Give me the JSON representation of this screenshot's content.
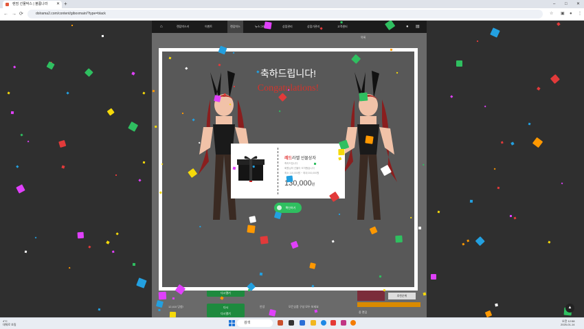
{
  "browser": {
    "tab_title": "랜덤 선물박스 | 볼룸나라",
    "new_tab": "+",
    "minimize": "–",
    "maximize": "□",
    "close": "✕",
    "back": "←",
    "forward": "→",
    "reload": "⟳",
    "url": "dolrama2.com/content/giboxmain/?type=black"
  },
  "site_nav": {
    "home": "⌂",
    "items": [
      "랜덤박스키",
      "이벤트",
      "랜덤박스",
      "뉴스그래픽",
      "상점관리",
      "상점가관리",
      "고객센터"
    ],
    "active_index": 2
  },
  "modal": {
    "title_ko": "축하드립니다!",
    "title_en": "Congatulations!",
    "product": {
      "name_prefix": "레드",
      "name_rest": "라벨 선물상자",
      "line1": "축하드립니다",
      "line2": "회원님의 선물이 도착했습니다",
      "line3": "최소 110,000원 ~ 최대 200,000원",
      "price": "130,000",
      "price_unit": "원"
    },
    "confirm_label": "확인하기"
  },
  "page_below": {
    "btn1": "다시열기",
    "btn2_line1": "다시",
    "btn2_line2": "다시열기",
    "text1": "12,410 당첨!",
    "text2": "안녕",
    "text3": "모든상품 구성 모두 보세요",
    "right_badge": "추천순위",
    "right_label": "중 랜덤",
    "right_top": "목록"
  },
  "taskbar": {
    "weather_temp": "4°C",
    "weather_desc": "대체로 흐림",
    "search_placeholder": "검색",
    "time": "오전 12:58",
    "date": "2025-01-14"
  },
  "colors": {
    "accent_red": "#d4332b",
    "confirm_green": "#2fbf60",
    "modal_bg": "#585858"
  }
}
